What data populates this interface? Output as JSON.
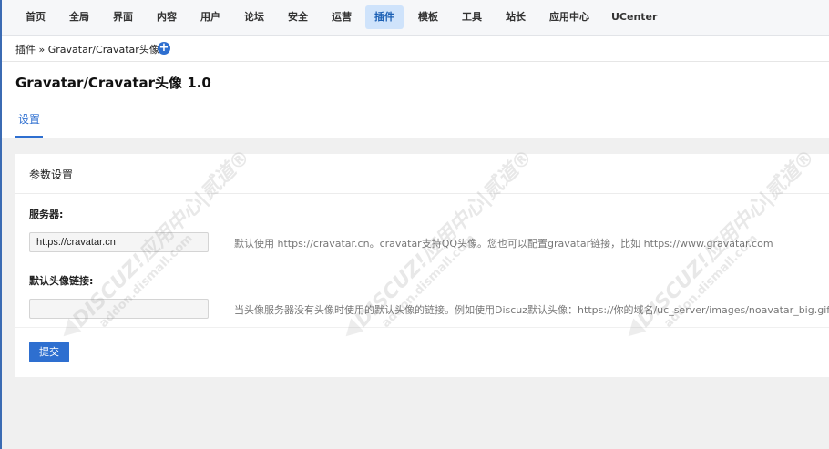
{
  "nav": {
    "items": [
      {
        "label": "首页"
      },
      {
        "label": "全局"
      },
      {
        "label": "界面"
      },
      {
        "label": "内容"
      },
      {
        "label": "用户"
      },
      {
        "label": "论坛"
      },
      {
        "label": "安全"
      },
      {
        "label": "运营"
      },
      {
        "label": "插件"
      },
      {
        "label": "模板"
      },
      {
        "label": "工具"
      },
      {
        "label": "站长"
      },
      {
        "label": "应用中心"
      },
      {
        "label": "UCenter"
      }
    ],
    "active": "插件"
  },
  "breadcrumb": {
    "text": "插件 » Gravatar/Cravatar头像",
    "add_icon": "plus-circle-icon"
  },
  "page": {
    "title": "Gravatar/Cravatar头像 1.0",
    "tab": "设置"
  },
  "panel": {
    "title": "参数设置",
    "fields": [
      {
        "label": "服务器:",
        "value": "https://cravatar.cn",
        "placeholder": "",
        "hint": "默认使用 https://cravatar.cn。cravatar支持QQ头像。您也可以配置gravatar链接，比如 https://www.gravatar.com"
      },
      {
        "label": "默认头像链接:",
        "value": "",
        "placeholder": "",
        "hint": "当头像服务器没有头像时使用的默认头像的链接。例如使用Discuz默认头像：https://你的域名/uc_server/images/noavatar_big.gif。"
      }
    ],
    "submit": "提交"
  },
  "watermark": {
    "line1": "DISCUZ!应用中心|贰道®",
    "line2": "addon.dismall.com"
  },
  "colors": {
    "accent": "#2e6fd0",
    "nav_active_bg": "#cfe3fb",
    "page_bg": "#f0f0f0"
  }
}
